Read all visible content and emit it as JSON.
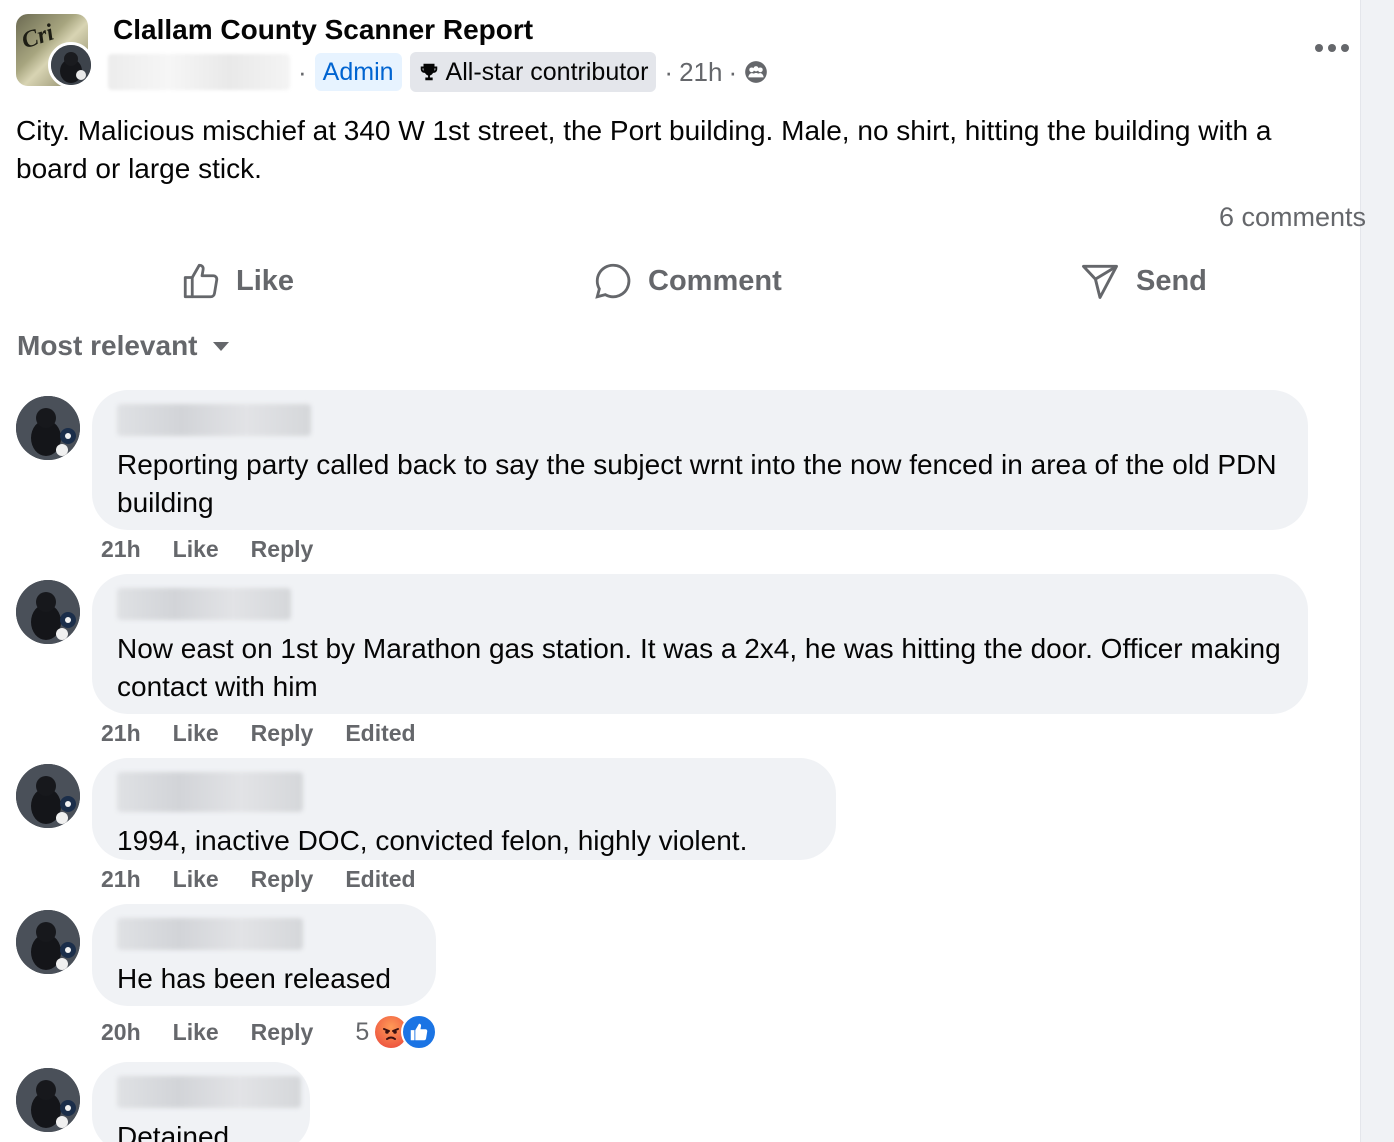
{
  "post": {
    "group_name": "Clallam County Scanner Report",
    "group_avatar_text": "Cri",
    "admin_badge": "Admin",
    "contributor_badge": "All-star contributor",
    "time": "21h",
    "body": "City. Malicious mischief at 340 W 1st street, the Port building. Male, no shirt, hitting the building with a board or large stick.",
    "comment_count": "6 comments"
  },
  "actions": {
    "like_label": "Like",
    "comment_label": "Comment",
    "send_label": "Send"
  },
  "sort": {
    "label": "Most relevant"
  },
  "comments": [
    {
      "text": "Reporting party called back to say the subject wrnt into the now fenced in area of the old PDN building",
      "time": "21h",
      "like": "Like",
      "reply": "Reply",
      "edited": ""
    },
    {
      "text": "Now east on 1st by Marathon gas station. It was a 2x4, he was hitting the door. Officer making contact with him",
      "time": "21h",
      "like": "Like",
      "reply": "Reply",
      "edited": "Edited"
    },
    {
      "text": "1994, inactive DOC, convicted felon, highly violent.",
      "time": "21h",
      "like": "Like",
      "reply": "Reply",
      "edited": "Edited"
    },
    {
      "text": "He has been released",
      "time": "20h",
      "like": "Like",
      "reply": "Reply",
      "edited": "",
      "reaction_count": "5"
    },
    {
      "text": "Detained",
      "time": "",
      "like": "",
      "reply": "",
      "edited": ""
    }
  ],
  "icons": {
    "more": "more-horizontal-icon",
    "trophy": "trophy-icon",
    "audience": "group-audience-icon",
    "like": "thumbs-up-icon",
    "comment": "speech-bubble-icon",
    "send": "send-icon",
    "sort": "caret-down-icon",
    "reaction_angry": "angry-reaction-icon",
    "reaction_like": "like-reaction-icon"
  },
  "colors": {
    "link_blue": "#0064d1",
    "admin_bg": "#e7f3ff",
    "secondary_text": "#65676b",
    "bubble_bg": "#f0f2f5",
    "like_blue": "#1b74e4"
  }
}
